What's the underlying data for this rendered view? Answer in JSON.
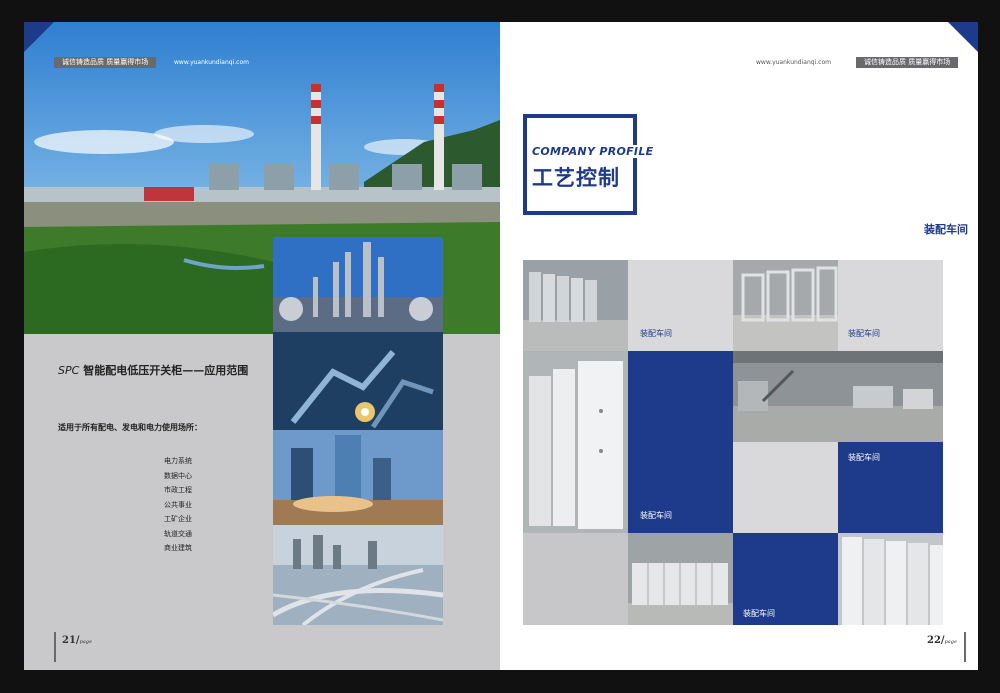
{
  "left_page": {
    "slogan": "诚信铸造品质 质量赢得市场",
    "website": "www.yuankundianqi.com",
    "title_prefix": "SPC",
    "title": "智能配电低压开关柜——应用范围",
    "subtitle": "适用于所有配电、发电和电力使用场所：",
    "uses": [
      "电力系统",
      "数据中心",
      "市政工程",
      "公共事业",
      "工矿企业",
      "轨道交通",
      "商业建筑"
    ],
    "page_number": "21",
    "page_word": "page"
  },
  "right_page": {
    "slogan": "诚信铸造品质 质量赢得市场",
    "website": "www.yuankundianqi.com",
    "heading_en": "COMPANY PROFILE",
    "heading_cn": "工艺控制",
    "section_label": "装配车间",
    "grid_labels": [
      "装配车间",
      "装配车间",
      "装配车间",
      "装配车间",
      "装配车间"
    ],
    "page_number": "22",
    "page_word": "page"
  },
  "colors": {
    "brand_blue": "#1e3a8a",
    "panel_grey": "#c9c9cb",
    "tag_grey": "#6a6a6c"
  }
}
